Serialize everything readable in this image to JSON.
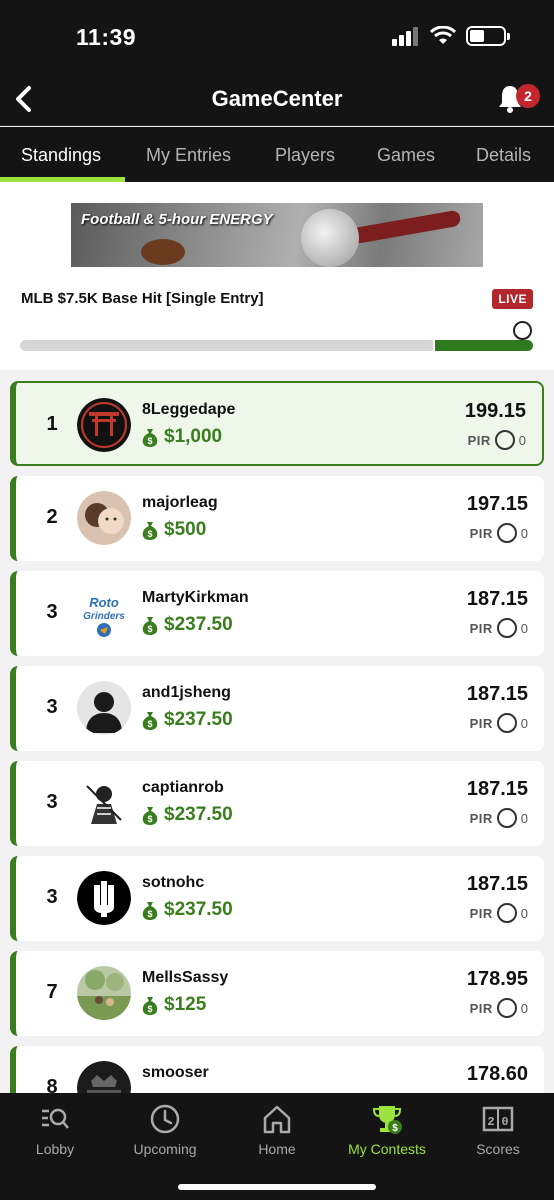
{
  "status_bar": {
    "time": "11:39"
  },
  "header": {
    "title": "GameCenter",
    "notification_count": "2"
  },
  "tabs": [
    {
      "label": "Standings",
      "active": true
    },
    {
      "label": "My Entries",
      "active": false
    },
    {
      "label": "Players",
      "active": false
    },
    {
      "label": "Games",
      "active": false
    },
    {
      "label": "Details",
      "active": false
    }
  ],
  "contest": {
    "banner_text": "Football & 5-hour ENERGY",
    "name": "MLB $7.5K Base Hit [Single Entry]",
    "status": "LIVE"
  },
  "standings": [
    {
      "rank": "1",
      "username": "8Leggedape",
      "prize": "$1,000",
      "score": "199.15",
      "pir_label": "PIR",
      "pir": "0",
      "highlight": true
    },
    {
      "rank": "2",
      "username": "majorleag",
      "prize": "$500",
      "score": "197.15",
      "pir_label": "PIR",
      "pir": "0"
    },
    {
      "rank": "3",
      "username": "MartyKirkman",
      "prize": "$237.50",
      "score": "187.15",
      "pir_label": "PIR",
      "pir": "0",
      "avatar_text": "Roto Grinders"
    },
    {
      "rank": "3",
      "username": "and1jsheng",
      "prize": "$237.50",
      "score": "187.15",
      "pir_label": "PIR",
      "pir": "0"
    },
    {
      "rank": "3",
      "username": "captianrob",
      "prize": "$237.50",
      "score": "187.15",
      "pir_label": "PIR",
      "pir": "0"
    },
    {
      "rank": "3",
      "username": "sotnohc",
      "prize": "$237.50",
      "score": "187.15",
      "pir_label": "PIR",
      "pir": "0"
    },
    {
      "rank": "7",
      "username": "MellsSassy",
      "prize": "$125",
      "score": "178.95",
      "pir_label": "PIR",
      "pir": "0"
    },
    {
      "rank": "8",
      "username": "smooser",
      "prize": "",
      "score": "178.60",
      "pir_label": "",
      "pir": ""
    }
  ],
  "bottom_nav": [
    {
      "label": "Lobby",
      "icon": "search-list-icon"
    },
    {
      "label": "Upcoming",
      "icon": "clock-icon"
    },
    {
      "label": "Home",
      "icon": "home-icon"
    },
    {
      "label": "My Contests",
      "icon": "trophy-icon",
      "active": true
    },
    {
      "label": "Scores",
      "icon": "scoreboard-icon"
    }
  ],
  "colors": {
    "accent": "#9be33d",
    "money": "#3a7d1e",
    "live": "#b3262c",
    "header_bg": "#141414"
  }
}
